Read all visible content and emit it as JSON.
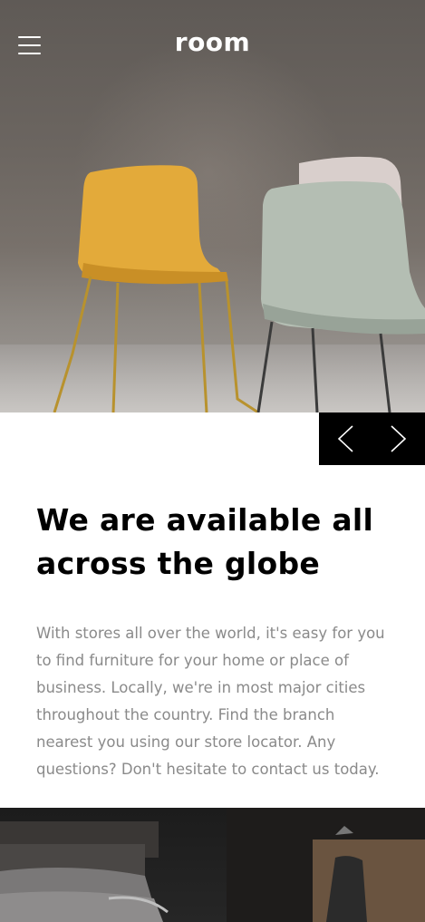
{
  "header": {
    "logo_text": "room",
    "menu_icon": "hamburger-menu-icon"
  },
  "hero": {
    "image": "chairs-photo",
    "slider_controls": {
      "prev_icon": "chevron-left-icon",
      "next_icon": "chevron-right-icon",
      "background": "#000000"
    }
  },
  "main": {
    "headline_line1": "We are available all",
    "headline_line2": "across the globe",
    "body_lines": [
      "With stores all over the world, it's easy for you",
      "to find furniture for your home or place of",
      "business. Locally, we're in most major cities",
      "throughout the country. Find the branch",
      "nearest you using our store locator. Any",
      "questions? Don't hesitate to contact us today."
    ]
  },
  "colors": {
    "headline": "#000000",
    "body_text": "#8a8a8a",
    "chair_yellow": "#e3aa3a",
    "chair_mint": "#b4beb3"
  }
}
